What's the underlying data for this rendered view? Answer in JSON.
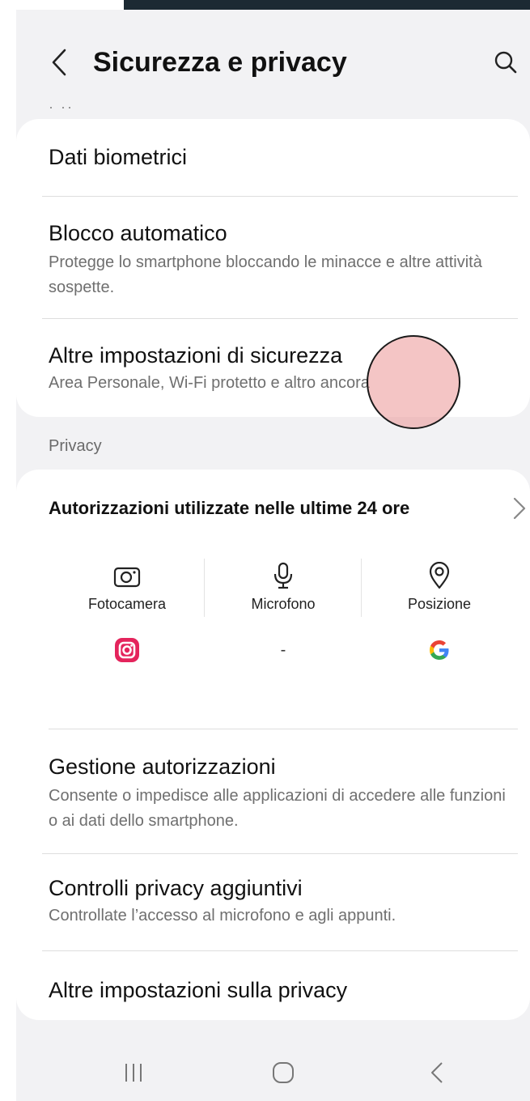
{
  "header": {
    "title": "Sicurezza e privacy",
    "back_icon": "chevron-left-icon",
    "search_icon": "search-icon"
  },
  "cut_text": "·           ··",
  "security": {
    "items": [
      {
        "title": "Dati biometrici"
      },
      {
        "title": "Blocco automatico",
        "subtitle": "Protegge lo smartphone bloccando le minacce e altre attività sospette."
      },
      {
        "title": "Altre impostazioni di sicurezza",
        "subtitle": "Area Personale, Wi-Fi protetto e altro ancora"
      }
    ]
  },
  "privacy_section_label": "Privacy",
  "permissions": {
    "title": "Autorizzazioni utilizzate nelle ultime 24 ore",
    "columns": [
      {
        "label": "Fotocamera",
        "icon": "camera-icon",
        "app_icon": "instagram-icon"
      },
      {
        "label": "Microfono",
        "icon": "microphone-icon",
        "app_text": "-"
      },
      {
        "label": "Posizione",
        "icon": "location-pin-icon",
        "app_icon": "google-icon"
      }
    ]
  },
  "privacy": {
    "items": [
      {
        "title": "Gestione autorizzazioni",
        "subtitle": "Consente o impedisce alle applicazioni di accedere alle funzioni o ai dati dello smartphone."
      },
      {
        "title": "Controlli privacy aggiuntivi",
        "subtitle": "Controllate l’accesso al microfono e agli appunti."
      },
      {
        "title": "Altre impostazioni sulla privacy"
      }
    ]
  },
  "colors": {
    "instagram": "#e4245c",
    "accent_touch": "#eb9696"
  }
}
